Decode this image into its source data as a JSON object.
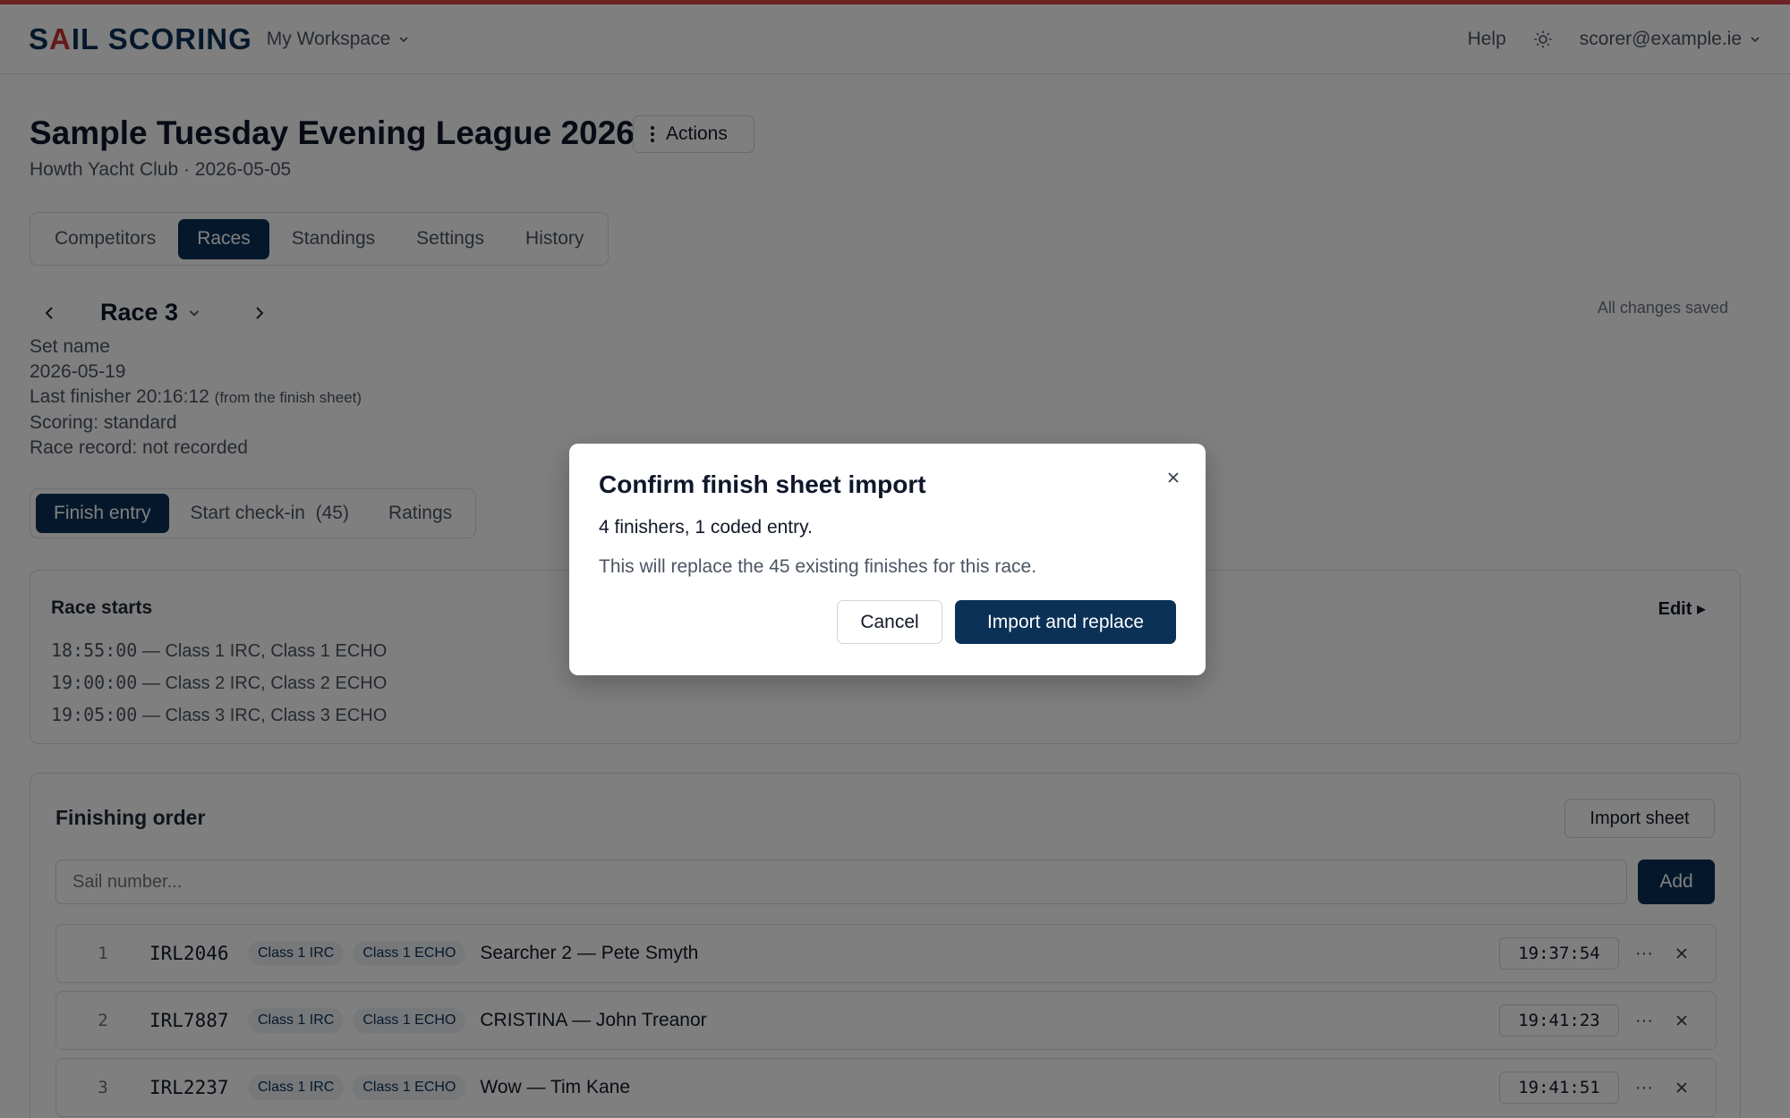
{
  "brand": {
    "logo_text_1": "S",
    "logo_text_a": "A",
    "logo_text_2": "IL SCORING",
    "accent_color": "#c8352f",
    "primary_color": "#0b3156"
  },
  "topbar": {
    "workspace": "My Workspace",
    "help": "Help",
    "account": "scorer@example.ie",
    "theme_icon": "sun-icon"
  },
  "header": {
    "title": "Sample Tuesday Evening League 2026",
    "actions_label": "Actions",
    "subtitle": "Howth Yacht Club · 2026-05-05"
  },
  "tabs": [
    {
      "label": "Competitors",
      "active": false
    },
    {
      "label": "Races",
      "active": true
    },
    {
      "label": "Standings",
      "active": false
    },
    {
      "label": "Settings",
      "active": false
    },
    {
      "label": "History",
      "active": false
    }
  ],
  "race": {
    "title": "Race 3",
    "saved_status": "All changes saved",
    "set_name": "Set name",
    "date": "2026-05-19",
    "last_finisher": "Last finisher 20:16:12",
    "last_finisher_note": "(from the finish sheet)",
    "scoring": "Scoring: standard",
    "record": "Race record: not recorded"
  },
  "subtabs": [
    {
      "label": "Finish entry",
      "active": true
    },
    {
      "label": "Start check-in  (45)",
      "active": false
    },
    {
      "label": "Ratings",
      "active": false
    }
  ],
  "starts": {
    "title": "Race starts",
    "edit_label": "Edit ▸",
    "lines": [
      {
        "time": "18:55:00",
        "classes": " — Class 1 IRC, Class 1 ECHO"
      },
      {
        "time": "19:00:00",
        "classes": " — Class 2 IRC, Class 2 ECHO"
      },
      {
        "time": "19:05:00",
        "classes": " — Class 3 IRC, Class 3 ECHO"
      }
    ]
  },
  "finishing": {
    "title": "Finishing order",
    "import_label": "Import sheet",
    "input_placeholder": "Sail number...",
    "add_label": "Add",
    "rows": [
      {
        "pos": "1",
        "sail": "IRL2046",
        "chip1": "Class 1 IRC",
        "chip2": "Class 1 ECHO",
        "boat": "Searcher 2 — Pete Smyth",
        "time": "19:37:54"
      },
      {
        "pos": "2",
        "sail": "IRL7887",
        "chip1": "Class 1 IRC",
        "chip2": "Class 1 ECHO",
        "boat": "CRISTINA — John Treanor",
        "time": "19:41:23"
      },
      {
        "pos": "3",
        "sail": "IRL2237",
        "chip1": "Class 1 IRC",
        "chip2": "Class 1 ECHO",
        "boat": "Wow — Tim Kane",
        "time": "19:41:51"
      }
    ]
  },
  "modal": {
    "title": "Confirm finish sheet import",
    "summary": "4 finishers, 1 coded entry.",
    "warning": "This will replace the 45 existing finishes for this race.",
    "cancel_label": "Cancel",
    "confirm_label": "Import and replace"
  }
}
